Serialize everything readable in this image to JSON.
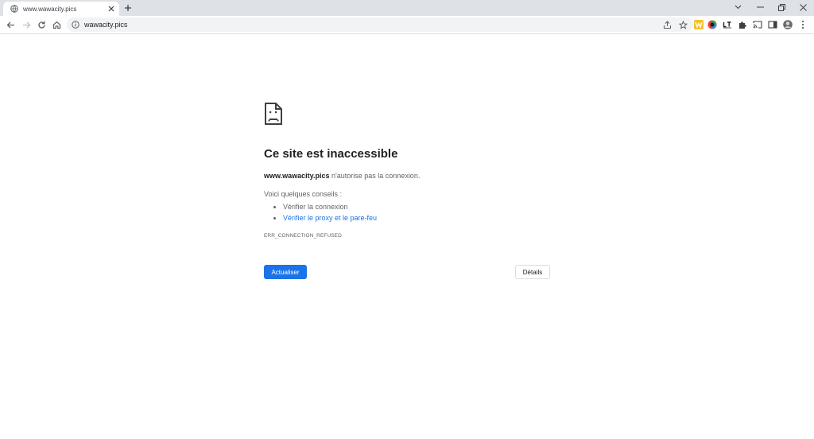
{
  "tab": {
    "title": "www.wawacity.pics",
    "close_icon": "close-icon",
    "favicon": "globe-icon"
  },
  "omnibox": {
    "url": "wawacity.pics"
  },
  "page": {
    "heading": "Ce site est inaccessible",
    "domain": "www.wawacity.pics",
    "message_suffix": " n'autorise pas la connexion.",
    "tips_title": "Voici quelques conseils :",
    "tips": [
      "Vérifier la connexion",
      "Vérifier le proxy et le pare-feu"
    ],
    "error_code": "ERR_CONNECTION_REFUSED",
    "reload_label": "Actualiser",
    "details_label": "Détails"
  },
  "colors": {
    "accent": "#1a73e8",
    "tabstrip": "#dee1e6",
    "text_muted": "#5f6368"
  }
}
